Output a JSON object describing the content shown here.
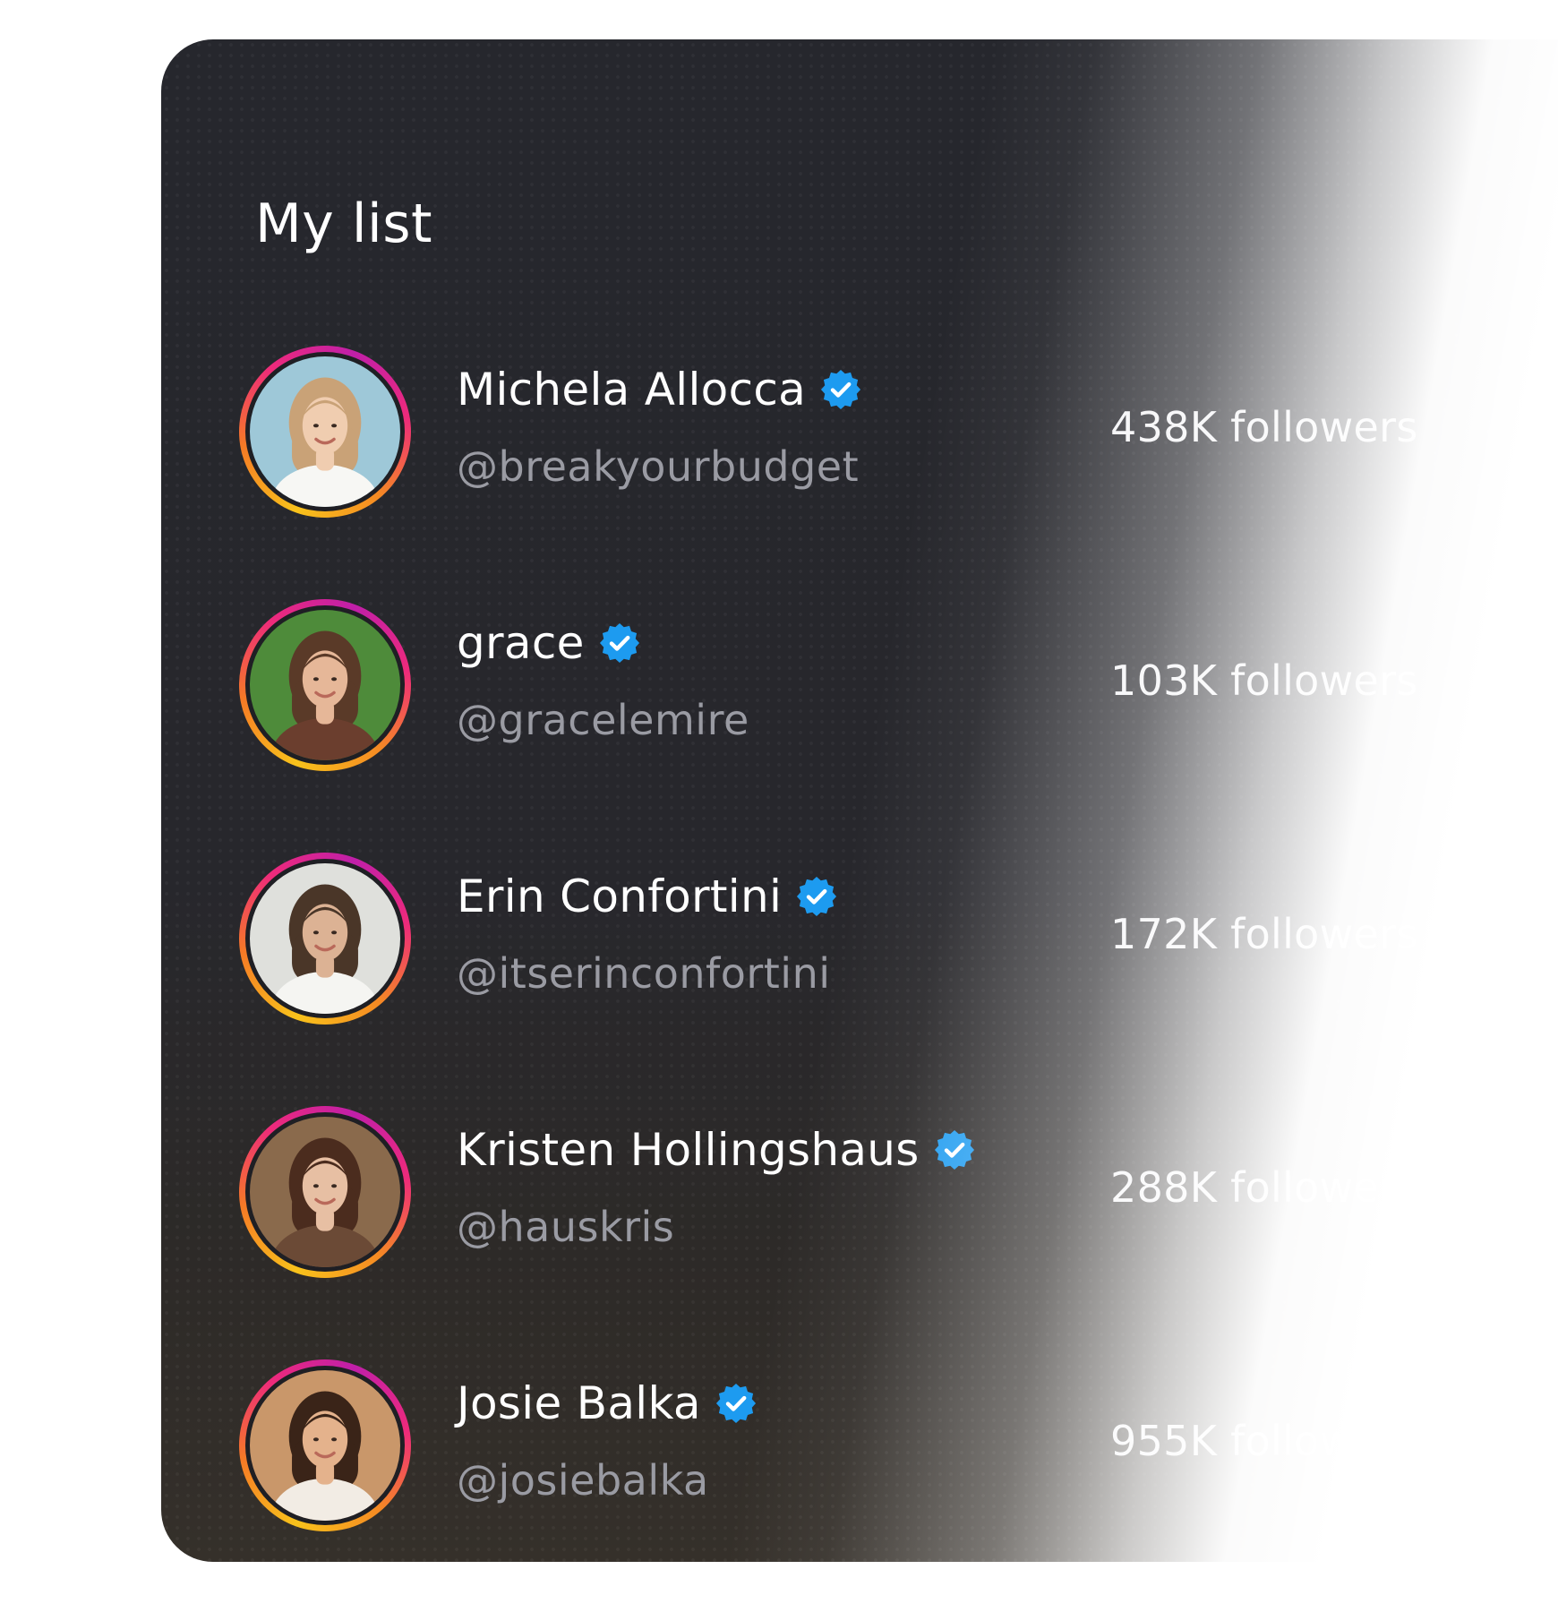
{
  "list": {
    "title": "My list",
    "items": [
      {
        "name": "Michela Allocca",
        "verified": true,
        "handle": "@breakyourbudget",
        "followers": "438K followers",
        "avatar_bg": "#9ec8d8",
        "hair": "#c9a277",
        "skin": "#f0cdb0",
        "top": "#f7f7f4"
      },
      {
        "name": "grace",
        "verified": true,
        "handle": "@gracelemire",
        "followers": "103K followers",
        "avatar_bg": "#4e8b3a",
        "hair": "#5a3a28",
        "skin": "#e6b798",
        "top": "#6b3e2e"
      },
      {
        "name": "Erin Confortini",
        "verified": true,
        "handle": "@itserinconfortini",
        "followers": "172K followers",
        "avatar_bg": "#dfe0dc",
        "hair": "#4a3628",
        "skin": "#dcb294",
        "top": "#f5f5f2"
      },
      {
        "name": "Kristen Hollingshaus",
        "verified": true,
        "handle": "@hauskris",
        "followers": "288K followers",
        "avatar_bg": "#8a6a4c",
        "hair": "#4b2c1e",
        "skin": "#e7bfa3",
        "top": "#6b4a36"
      },
      {
        "name": "Josie Balka",
        "verified": true,
        "handle": "@josiebalka",
        "followers": "955K followers",
        "avatar_bg": "#c9976a",
        "hair": "#3a2418",
        "skin": "#e4b28c",
        "top": "#f2ece4"
      }
    ]
  },
  "colors": {
    "card_bg": "#26272d",
    "verified_badge": "#1d9bf0",
    "handle_text": "#9a9ba3",
    "ring_gradient": [
      "#f8c21b",
      "#f57a26",
      "#ee2a7b",
      "#c01fa9"
    ]
  },
  "icons": {
    "verified": "verified-badge-icon"
  }
}
